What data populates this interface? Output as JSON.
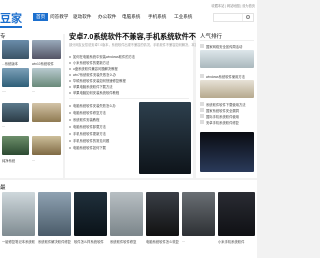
{
  "site": {
    "logo": "豆家",
    "top_links": "收藏本站 | 网站地图 | 设为首页"
  },
  "nav": [
    "首页",
    "问答教学",
    "驱动软件",
    "办公软件",
    "电脑系统",
    "手机系统",
    "工业系统"
  ],
  "search": {
    "placeholder": ""
  },
  "left": {
    "section_title": "专",
    "captions": [
      "...系统版本",
      "....",
      "win10系统软件",
      "...",
      "...",
      "纯净系统",
      "..."
    ]
  },
  "mid": {
    "headline": "安卓7.0系统软件不兼容,手机系统软件不兼",
    "sub": "部分网友反馈说安卓7.0版本，系统软件出现不兼容的情况，手机软件不兼容如何解决，本文为您详细的讲解一下",
    "list": [
      "如何在电脑系统中安装windows软件的方法",
      "小米系统软件的更新方法",
      "u盘系统软件兼容问题解决教程",
      "win7系统软件安装失败怎么办",
      "华硕系统软件安装如何快速修复教程",
      "苹果电脑系统软件下载方法",
      "苹果电脑如何安装系统软件教程",
      "电脑系统软件安装失败怎么办",
      "电脑系统软件修复方法",
      "系统软件安装教程",
      "电脑系统软件卸载方法",
      "手机系统软件更新方法",
      "手机系统软件的常见问题",
      "电脑系统软件如何下载"
    ]
  },
  "right": {
    "section_title": "人气排行",
    "items": [
      "国家网络安全宣传周活动",
      "windows系统软件使用方法",
      "...",
      "系统软件软件下载使用方法",
      "国家系统软件安全漏洞",
      "国际手机系统软件使用",
      "安卓手机系统软件修复"
    ]
  },
  "bottom": {
    "section_title": "最",
    "captions": [
      "一键修复笔记本系统软件",
      "系统软件解决软件修复",
      "软件怎么样系统软件",
      "系统软件软件修复",
      "电脑系统软件怎么恢复",
      "...",
      "小米手机系统软件"
    ]
  }
}
